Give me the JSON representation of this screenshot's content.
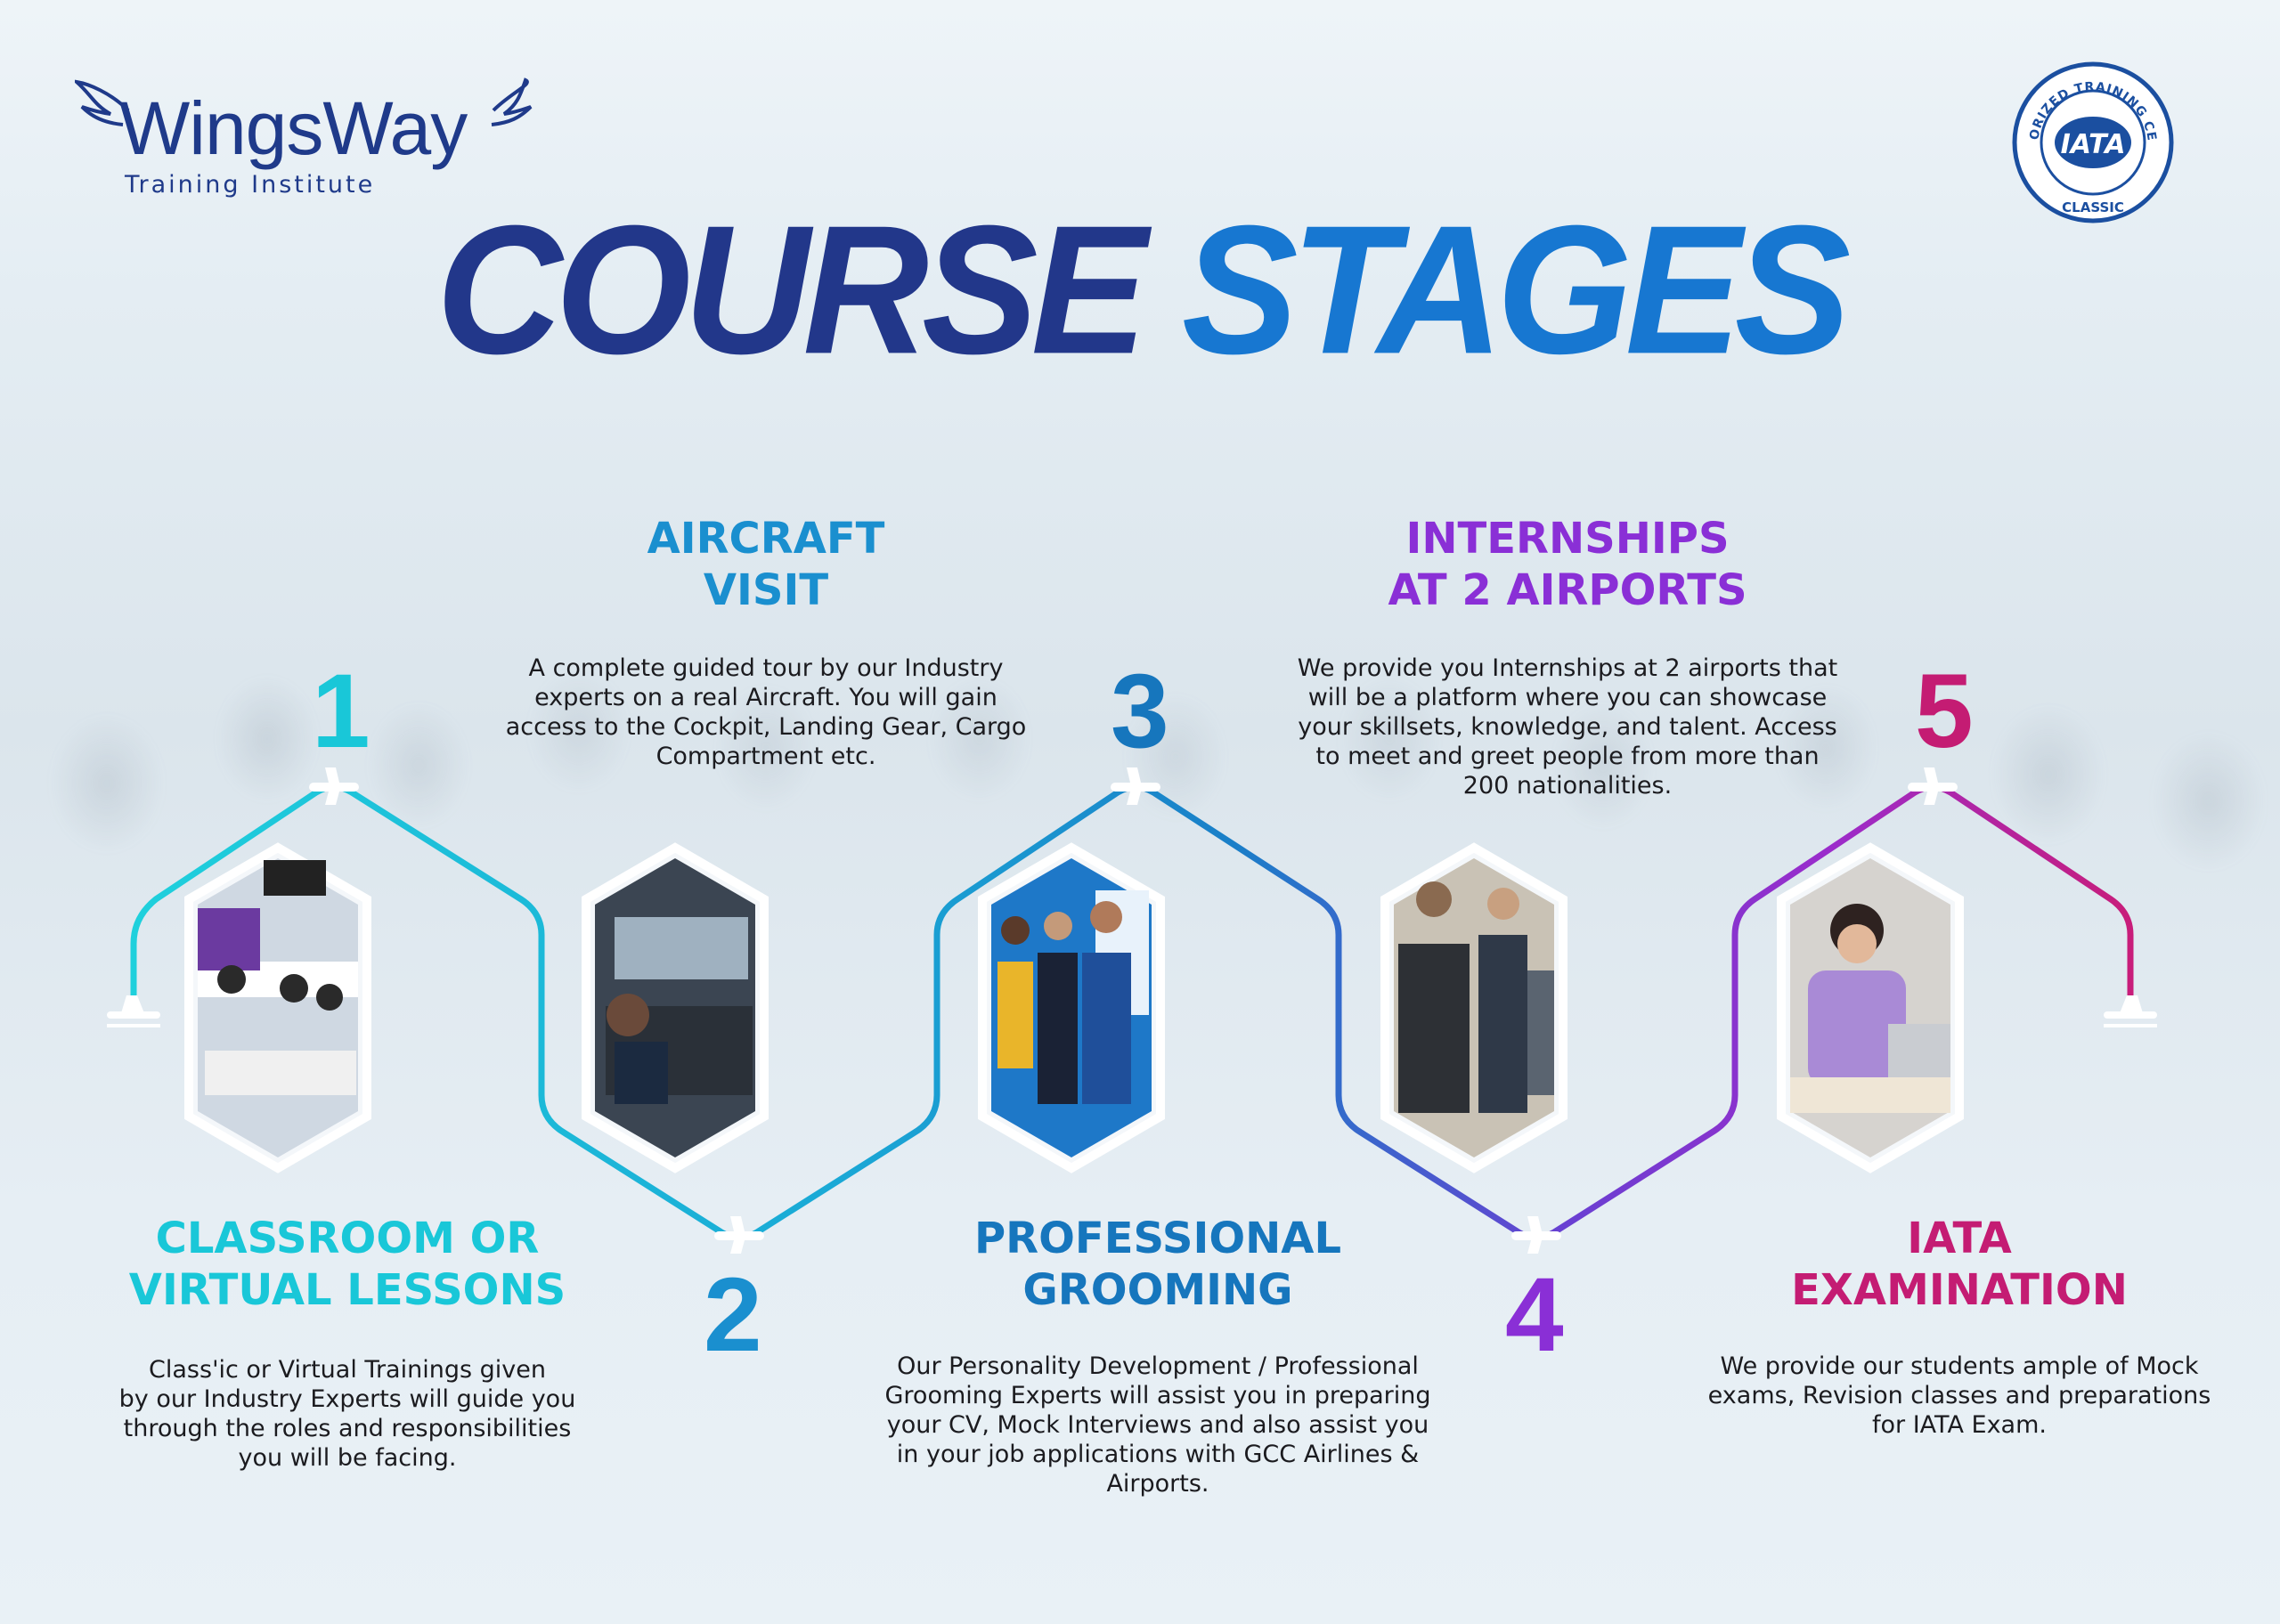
{
  "brand": {
    "name": "WingsWay",
    "tagline": "Training Institute"
  },
  "seal": {
    "arc_text": "AUTHORIZED TRAINING CENTER",
    "center": "IATA",
    "bottom": "CLASSIC"
  },
  "title": {
    "word1": "COURSE",
    "word2": "STAGES"
  },
  "stages": [
    {
      "number": "1",
      "heading": "CLASSROOM OR\nVIRTUAL LESSONS",
      "description": "Class'ic or Virtual Trainings given\nby our Industry Experts will guide you\nthrough the roles and responsibilities\nyou will be facing.",
      "photo": "classroom-photo",
      "color": "#19c7d8"
    },
    {
      "number": "2",
      "heading": "AIRCRAFT\nVISIT",
      "description": "A complete guided tour by our Industry\nexperts on a real Aircraft. You will gain\naccess to the Cockpit, Landing Gear, Cargo\nCompartment etc.",
      "photo": "cockpit-photo",
      "color": "#1a8fcf"
    },
    {
      "number": "3",
      "heading": "PROFESSIONAL\nGROOMING",
      "description": "Our Personality Development / Professional\nGrooming Experts will assist you in preparing\nyour CV, Mock Interviews and also assist you\nin your job applications with GCC Airlines &\nAirports.",
      "photo": "grooming-photo",
      "color": "#1676bd"
    },
    {
      "number": "4",
      "heading": "INTERNSHIPS\nAT 2 AIRPORTS",
      "description": "We provide you Internships at 2 airports that\nwill be a platform where you can showcase\nyour skillsets, knowledge, and talent. Access\nto meet and greet people from more than\n200 nationalities.",
      "photo": "airport-photo",
      "color": "#8a2fd6"
    },
    {
      "number": "5",
      "heading": "IATA\nEXAMINATION",
      "description": "We provide our students ample of Mock\nexams, Revision classes and preparations\nfor IATA Exam.",
      "photo": "exam-photo",
      "color": "#c41c73"
    }
  ],
  "colors": {
    "title_dark": "#22378a",
    "title_light": "#1777d1",
    "brand_blue": "#1f3a8a"
  }
}
